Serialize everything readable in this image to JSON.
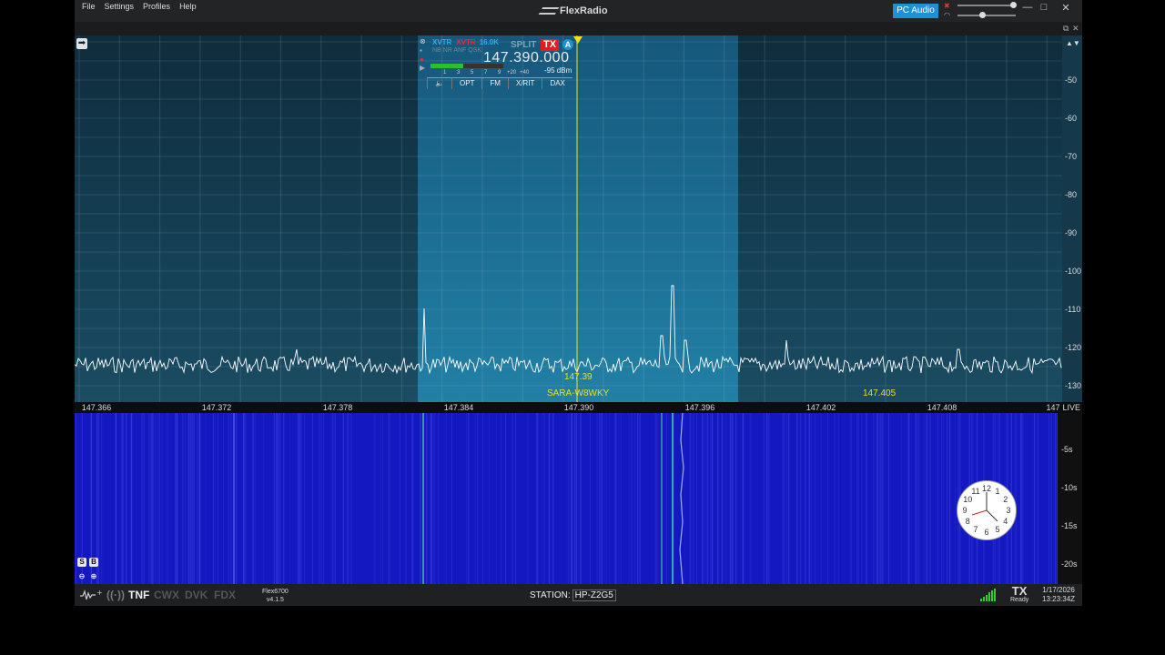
{
  "app": {
    "brand": "FlexRadio"
  },
  "menu": {
    "items": [
      "File",
      "Settings",
      "Profiles",
      "Help"
    ]
  },
  "audio": {
    "pc_audio_label": "PC Audio",
    "speaker_muted": true,
    "master_volume": 0.96,
    "headphone_volume": 0.4
  },
  "window": {
    "minimize": "—",
    "maximize": "□",
    "close": "✕"
  },
  "subbar": {
    "restore": "⧉",
    "close": "✕"
  },
  "slice": {
    "xvtr1": "XVTR",
    "xvtr2": "XVTR",
    "bandwidth": "16.0K",
    "split_label": "SPLIT",
    "tx_label": "TX",
    "slice_letter": "A",
    "dsp_modes": "NB NR ANF QSK",
    "frequency": "147.390.000",
    "signal_dbm": "-95 dBm",
    "meter_ticks": [
      "1",
      "3",
      "5",
      "7",
      "9",
      "+20",
      "+40"
    ],
    "meter_level": 0.45,
    "buttons": {
      "speaker": "🔈",
      "opt": "OPT",
      "mode": "FM",
      "xrit": "X/RIT",
      "dax": "DAX"
    }
  },
  "panadapter": {
    "db_labels": [
      "-50",
      "-60",
      "-70",
      "-80",
      "-90",
      "-100",
      "-110",
      "-120",
      "-130"
    ],
    "freq_labels": [
      "147.366",
      "147.372",
      "147.378",
      "147.384",
      "147.390",
      "147.396",
      "147.402",
      "147.408",
      "147"
    ],
    "live_label": "LIVE",
    "slice_center_label": "147.39",
    "spot_label": "SARA-W8WKY",
    "memory_label": "147.405",
    "collapse_icon": "▲▼"
  },
  "waterfall": {
    "time_labels": [
      "-5s",
      "-10s",
      "-15s",
      "-20s"
    ],
    "s_button": "S",
    "b_button": "B",
    "clock_numbers": [
      "12",
      "1",
      "2",
      "3",
      "4",
      "5",
      "6",
      "7",
      "8",
      "9",
      "10",
      "11"
    ]
  },
  "statusbar": {
    "tnf": "TNF",
    "cwx": "CWX",
    "dvk": "DVK",
    "fdx": "FDX",
    "radio_model": "Flex6700",
    "radio_version": "v4.1.5",
    "station_label": "STATION:",
    "station_name": "HP-Z2G5",
    "tx_label": "TX",
    "tx_status": "Ready",
    "date": "1/17/2026",
    "time": "13:23:34Z"
  },
  "colors": {
    "accent": "#1e90d6",
    "tx_red": "#e02020",
    "marker_yellow": "#f0e020",
    "waterfall_blue": "#1418c0"
  }
}
